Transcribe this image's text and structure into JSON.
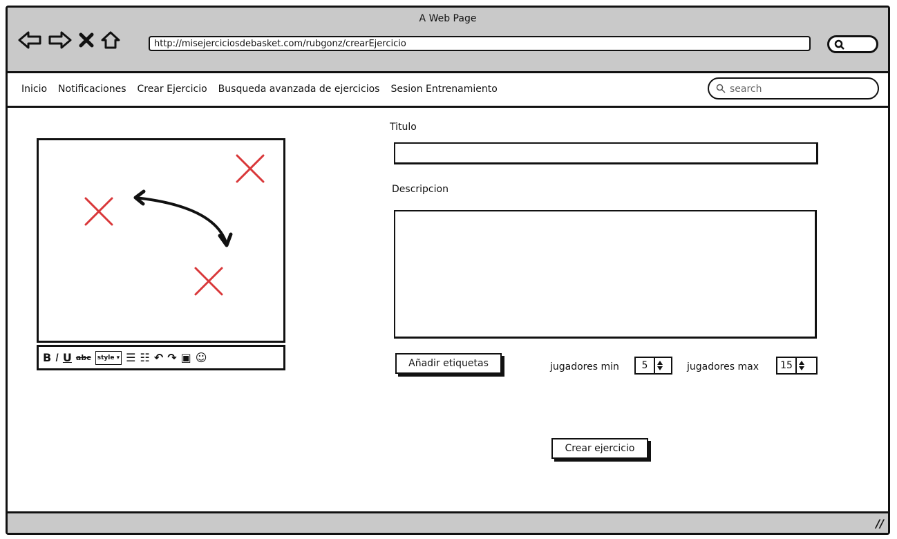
{
  "window": {
    "title": "A Web Page"
  },
  "browser": {
    "url": "http://misejerciciosdebasket.com/rubgonz/crearEjercicio",
    "back_icon": "back-arrow-icon",
    "forward_icon": "forward-arrow-icon",
    "stop_icon": "close-icon",
    "home_icon": "home-icon",
    "search_icon": "search-icon"
  },
  "menu": {
    "items": [
      {
        "label": "Inicio"
      },
      {
        "label": "Notificaciones"
      },
      {
        "label": "Crear Ejercicio"
      },
      {
        "label": "Busqueda avanzada de ejercicios"
      },
      {
        "label": "Sesion Entrenamiento"
      }
    ],
    "search_placeholder": "search"
  },
  "editor": {
    "style_label": "style",
    "tool_icons": [
      "bold-icon",
      "italic-icon",
      "underline-icon",
      "strikethrough-icon",
      "style-dropdown",
      "bullet-list-icon",
      "numbered-list-icon",
      "undo-icon",
      "redo-icon",
      "image-icon",
      "emoji-icon"
    ],
    "marker_color": "#d9383a"
  },
  "form": {
    "title_label": "Titulo",
    "title_value": "",
    "description_label": "Descripcion",
    "description_value": "",
    "add_tags_button": "Añadir etiquetas",
    "players_min_label": "jugadores min",
    "players_min_value": "5",
    "players_max_label": "jugadores max",
    "players_max_value": "15",
    "submit_button": "Crear ejercicio"
  },
  "colors": {
    "chrome": "#c9c9c9",
    "marker": "#d9383a"
  }
}
